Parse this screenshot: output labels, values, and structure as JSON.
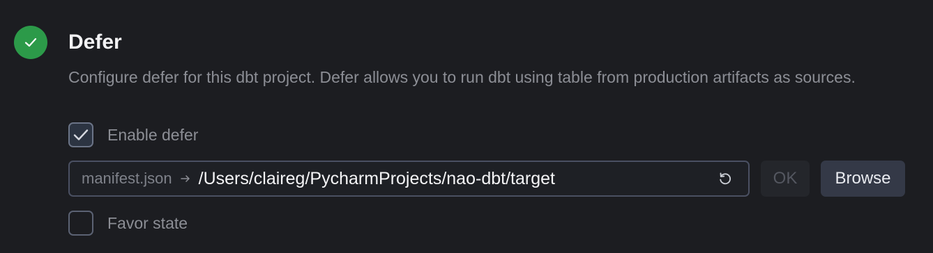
{
  "section": {
    "title": "Defer",
    "description": "Configure defer for this dbt project. Defer allows you to run dbt using table from production artifacts as sources.",
    "status": "complete"
  },
  "enable_defer": {
    "label": "Enable defer",
    "checked": true
  },
  "manifest": {
    "prefix": "manifest.json",
    "path": "/Users/claireg/PycharmProjects/nao-dbt/target"
  },
  "buttons": {
    "ok_label": "OK",
    "ok_enabled": false,
    "browse_label": "Browse"
  },
  "favor_state": {
    "label": "Favor state",
    "checked": false
  },
  "colors": {
    "background": "#1c1d21",
    "success": "#2c9a49",
    "title": "#f2f2f4",
    "muted_text": "#8c8e95",
    "field_border": "#4a5062",
    "browse_bg": "#343947"
  },
  "icons": {
    "status": "checkmark-icon",
    "checkbox_check": "checkmark-icon",
    "separator": "arrow-right-icon",
    "reset": "refresh-icon"
  }
}
